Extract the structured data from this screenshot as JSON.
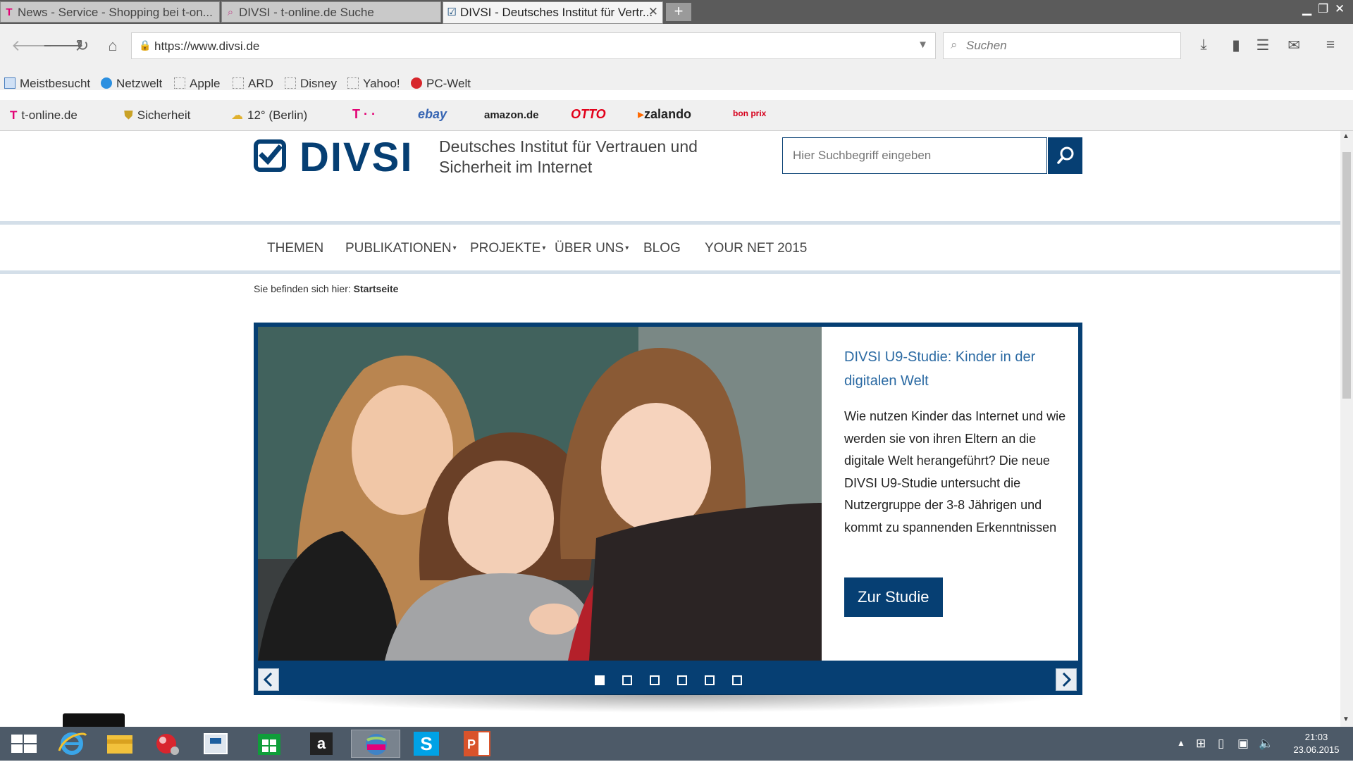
{
  "browser": {
    "tabs": [
      {
        "favicon": "T",
        "label": "News - Service - Shopping bei t-on..."
      },
      {
        "favicon": "⌕",
        "label": "DIVSI - t-online.de Suche"
      },
      {
        "favicon": "☑",
        "label": "DIVSI - Deutsches Institut für Vertr..."
      }
    ],
    "new_tab": "+",
    "url": "https://www.divsi.de",
    "search_placeholder": "Suchen",
    "bookmarks": [
      "Meistbesucht",
      "Netzwelt",
      "Apple",
      "ARD",
      "Disney",
      "Yahoo!",
      "PC-Welt"
    ],
    "links": {
      "tonline": "t-online.de",
      "sicherheit": "Sicherheit",
      "weather": "12° (Berlin)",
      "telekom": "T · ·",
      "ebay": "ebay",
      "amazon": "amazon.de",
      "otto": "OTTO",
      "zalando": "zalando",
      "bonprix": "bon prix"
    }
  },
  "site": {
    "logo_text": "DIVSI",
    "tagline": "Deutsches Institut für Vertrauen und Sicherheit im Internet",
    "search_placeholder": "Hier Suchbegriff eingeben",
    "menu": [
      "THEMEN",
      "PUBLIKATIONEN",
      "PROJEKTE",
      "ÜBER UNS",
      "BLOG",
      "YOUR NET 2015"
    ],
    "breadcrumb_prefix": "Sie befinden sich hier:",
    "breadcrumb_current": "Startseite",
    "slide": {
      "title": "DIVSI U9-Studie: Kinder in der digitalen Welt",
      "body": "Wie nutzen Kinder das Internet und wie werden sie von ihren Eltern an die digitale Welt herangeführt? Die neue DIVSI U9-Studie untersucht die Nutzergruppe der 3-8 Jährigen und kommt zu spannenden Erkenntnissen",
      "cta": "Zur Studie",
      "slide_count": 6,
      "active_slide": 1
    }
  },
  "taskbar": {
    "time": "21:03",
    "date": "23.06.2015"
  },
  "colors": {
    "brand": "#063f73",
    "link": "#2b6aa3",
    "menu_line": "#d4dfe9"
  }
}
